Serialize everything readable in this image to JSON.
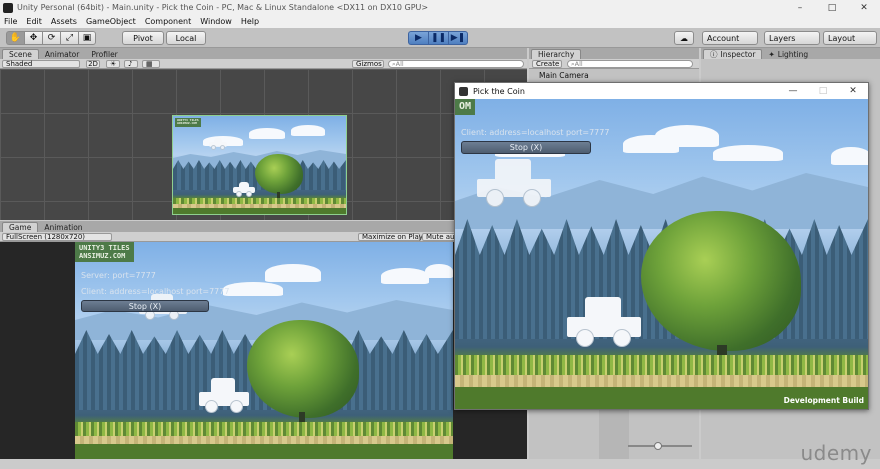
{
  "window": {
    "title": "Unity Personal (64bit) - Main.unity - Pick the Coin - PC, Mac & Linux Standalone <DX11 on DX10 GPU>",
    "min": "–",
    "max": "□",
    "close": "✕"
  },
  "menu": [
    "File",
    "Edit",
    "Assets",
    "GameObject",
    "Component",
    "Window",
    "Help"
  ],
  "toolbar": {
    "tools": [
      "✋",
      "✥",
      "⟳",
      "⤢",
      "▣"
    ],
    "pivot": "Pivot",
    "local": "Local",
    "play": "▶",
    "pause": "❚❚",
    "step": "▶❚",
    "cloud": "☁",
    "account": "Account",
    "layers": "Layers",
    "layout": "Layout"
  },
  "scene_panel": {
    "tabs": [
      "Scene",
      "Animator",
      "Profiler"
    ],
    "shading": "Shaded",
    "mode_2d": "2D",
    "gizmos": "Gizmos",
    "search": "All"
  },
  "game_panel": {
    "tabs": [
      "Game",
      "Animation"
    ],
    "resolution": "FullScreen (1280x720)",
    "maximize": "Maximize on Play",
    "mute": "Mute audio",
    "badge": "UNITY3 TILES\nANSIMUZ.COM",
    "server": "Server: port=7777",
    "client": "Client: address=localhost port=7777",
    "stop": "Stop (X)"
  },
  "hierarchy": {
    "tab": "Hierarchy",
    "create": "Create",
    "search": "All",
    "items": [
      "Main Camera"
    ]
  },
  "inspector": {
    "tabs": [
      "Inspector",
      "Lighting"
    ]
  },
  "standalone": {
    "title": "Pick the Coin",
    "badge": "OM",
    "client": "Client: address=localhost port=7777",
    "stop": "Stop (X)",
    "dev": "Development Build",
    "min": "—",
    "max": "□",
    "close": "✕"
  },
  "watermark": "udemy",
  "colors": {
    "play_blue": "#5b87c4",
    "scene_bg": "#474747",
    "badge_green": "#4d7a48"
  }
}
